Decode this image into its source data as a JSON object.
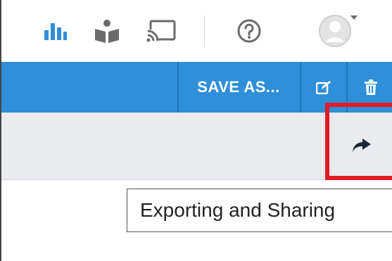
{
  "header": {
    "icons": [
      {
        "name": "reports-icon",
        "color": "#2f8fd8"
      },
      {
        "name": "learning-icon",
        "color": "#6b6b6b"
      },
      {
        "name": "cast-icon",
        "color": "#6b6b6b"
      },
      {
        "name": "help-icon",
        "color": "#6b6b6b"
      },
      {
        "name": "avatar-icon",
        "color": "#cfcfcf"
      }
    ]
  },
  "actionbar": {
    "save_as_label": "SAVE AS...",
    "edit_icon": "edit-icon",
    "delete_icon": "trash-icon",
    "color": "#2f8fd8"
  },
  "toolbar": {
    "share_icon": "share-icon"
  },
  "tooltip": {
    "text": "Exporting and Sharing"
  },
  "highlight": {
    "color": "#e21b23"
  }
}
